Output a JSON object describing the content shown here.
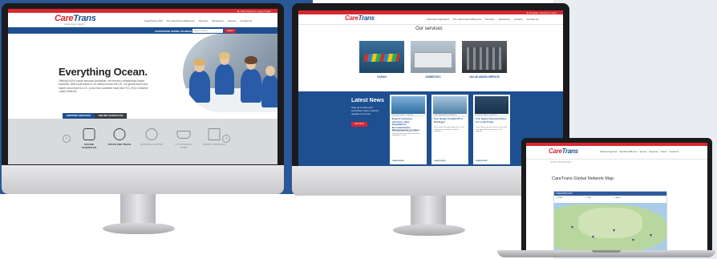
{
  "left_site": {
    "utility_links": "⊕ USA   Careers   Login   Track",
    "logo_care": "Care",
    "logo_trans": "Trans",
    "logo_tagline": "Global Ocean Logistics",
    "nav": [
      "Care/Trans+ PRI",
      "The Care/Trans Difference",
      "Services",
      "Resources",
      "Careers",
      "Contact Us"
    ],
    "ship_label": "CARETRANS VESSEL SCHEDULES",
    "ship_placeholder": "Select Location",
    "ship_button": "Search",
    "hero_title": "Everything Ocean.",
    "hero_text": "Offering 100% ocean services worldwide, we remain a relationship-based business. With local teams in 15 offices across the US, our global reach and import and export to U.S. (Less than container load) and FCL (Full Container Load) solutions.",
    "tabs": [
      "SHIPPING SERVICES",
      "ONLINE SCHEDULES"
    ],
    "tools": [
      {
        "label": "SAILING SCHEDULES",
        "icon": "calendar-icon",
        "active": true
      },
      {
        "label": "TRACK AND TRACE",
        "icon": "target-icon",
        "active": true
      },
      {
        "label": "BOOKING CENTER",
        "icon": "globe-icon",
        "active": false
      },
      {
        "label": "LCL BOOKING FORM",
        "icon": "ship-icon",
        "active": false
      },
      {
        "label": "WEEKLY BOOKING",
        "icon": "box-icon",
        "active": false
      }
    ],
    "arrow_left": "‹",
    "arrow_right": "›"
  },
  "middle_site": {
    "utility_links": "⊕ English   Careers   Login",
    "logo_care": "Care",
    "logo_trans": "Trans",
    "nav": [
      "Industries Supported",
      "The Care/Trans Difference",
      "Services",
      "Resources",
      "Careers",
      "Contact Us"
    ],
    "services_title": "Our services",
    "services": [
      "OCEAN",
      "DOMESTICS",
      "VALUE ADDED SERVICE"
    ],
    "news_title": "Latest News",
    "news_sub": "Stay up-to-date with CareTrans news, industry updates and more.",
    "news_button": "View More",
    "cards": [
      {
        "category": "INDUSTRY NEWS / LOGISTICS",
        "title": "Export Customer Advisory: New Regulations Documentation Requirements to China",
        "desc": "Care/Trans informs shippers of new documentation requirements that affect shipments to China...",
        "more": "LEARN MORE"
      },
      {
        "category": "CARETRANS ANNOUNCEMENTS",
        "title": "Can Ocean Freight OTI a Strategy?",
        "desc": "As we explore the advantages of an Ocean Transport Intermediary for shippers worldwide...",
        "more": "LEARN MORE"
      },
      {
        "category": "INDUSTRY NEWS / LOGISTICS",
        "title": "U.S. Import Demand Rises for Local Trade",
        "desc": "Ocean import volumes continue to rise amid a changing trade environment for US shippers...",
        "more": "LEARN MORE"
      }
    ]
  },
  "laptop_site": {
    "logo_care": "Care",
    "logo_trans": "Trans",
    "nav": [
      "Industries Supported",
      "Care/Trans Difference",
      "Services",
      "Resources",
      "Careers",
      "Contact Us"
    ],
    "breadcrumb": "HOME / NETWORK MAP",
    "map_title": "CareTrans Global Network Map",
    "map_top": "CARETRANS MAP",
    "legends": [
      "Office",
      "Port",
      "Agent"
    ]
  }
}
